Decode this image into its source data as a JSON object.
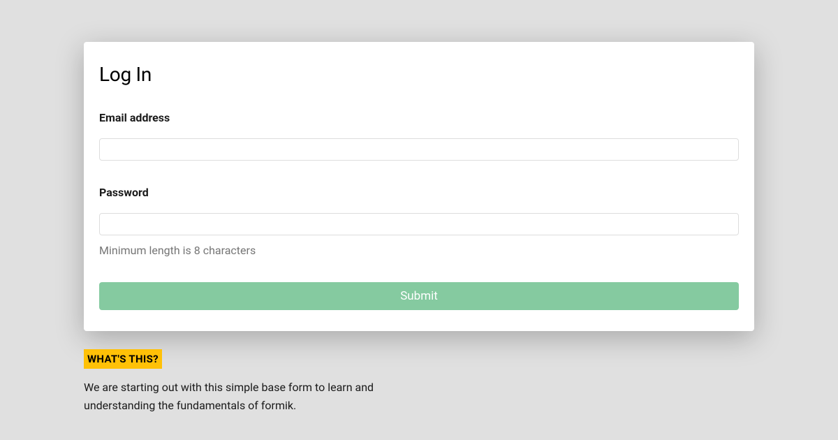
{
  "card": {
    "title": "Log In",
    "email": {
      "label": "Email address",
      "value": ""
    },
    "password": {
      "label": "Password",
      "value": "",
      "help": "Minimum length is 8 characters"
    },
    "submit_label": "Submit"
  },
  "info": {
    "badge": "WHAT'S THIS?",
    "description": "We are starting out with this simple base form to learn and understanding the fundamentals of formik."
  }
}
